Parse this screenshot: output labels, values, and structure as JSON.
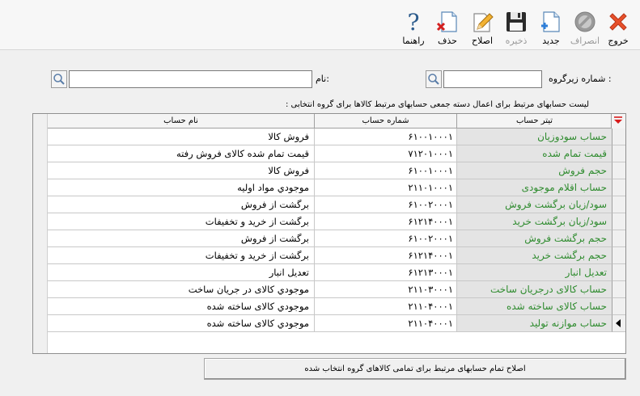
{
  "toolbar": {
    "buttons": [
      {
        "name": "exit",
        "label": "خروج",
        "icon": "close-x-icon",
        "enabled": true
      },
      {
        "name": "cancel",
        "label": "انصراف",
        "icon": "no-entry-icon",
        "enabled": false
      },
      {
        "name": "new",
        "label": "جدید",
        "icon": "new-document-icon",
        "enabled": true
      },
      {
        "name": "save",
        "label": "ذخیره",
        "icon": "floppy-disk-icon",
        "enabled": false
      },
      {
        "name": "edit",
        "label": "اصلاح",
        "icon": "pencil-document-icon",
        "enabled": true
      },
      {
        "name": "delete",
        "label": "حذف",
        "icon": "delete-document-icon",
        "enabled": true
      },
      {
        "name": "help",
        "label": "راهنما",
        "icon": "question-mark-icon",
        "enabled": true
      }
    ]
  },
  "filters": {
    "subgroup_label": "شماره زیرگروه :",
    "subgroup_value": "",
    "name_label": "نام:",
    "name_value": ""
  },
  "list_caption": "لیست حسابهای مرتبط برای اعمال دسته جمعی حسابهای مرتبط کالاها برای  گروه انتخابی :",
  "grid": {
    "columns": {
      "title": "تیتر حساب",
      "number": "شماره حساب",
      "name": "نام حساب"
    },
    "rows": [
      {
        "title": "حساب سودوزیان",
        "number": "۶۱۰۰۱۰۰۰۱",
        "name": "فروش کالا"
      },
      {
        "title": "قیمت تمام شده",
        "number": "۷۱۲۰۱۰۰۰۱",
        "name": "قیمت تمام شده کالای فروش رفته"
      },
      {
        "title": "حجم فروش",
        "number": "۶۱۰۰۱۰۰۰۱",
        "name": "فروش کالا"
      },
      {
        "title": "حساب اقلام موجودی",
        "number": "۲۱۱۰۱۰۰۰۱",
        "name": "موجودي مواد اولیه"
      },
      {
        "title": "سود/زیان برگشت فروش",
        "number": "۶۱۰۰۲۰۰۰۱",
        "name": "برگشت از فروش"
      },
      {
        "title": "سود/زیان برگشت خرید",
        "number": "۶۱۲۱۴۰۰۰۱",
        "name": "برگشت از خرید و تخفیفات"
      },
      {
        "title": "حجم برگشت فروش",
        "number": "۶۱۰۰۲۰۰۰۱",
        "name": "برگشت از فروش"
      },
      {
        "title": "حجم برگشت خرید",
        "number": "۶۱۲۱۴۰۰۰۱",
        "name": "برگشت از خرید و تخفیفات"
      },
      {
        "title": "تعدیل انبار",
        "number": "۶۱۲۱۳۰۰۰۱",
        "name": "تعدیل انبار"
      },
      {
        "title": "حساب کالای درجریان ساخت",
        "number": "۲۱۱۰۳۰۰۰۱",
        "name": "موجودي کالای در جریان ساخت"
      },
      {
        "title": "حساب کالای ساخته شده",
        "number": "۲۱۱۰۴۰۰۰۱",
        "name": "موجودي کالای ساخته شده"
      },
      {
        "title": "حساب موازنه تولید",
        "number": "۲۱۱۰۴۰۰۰۱",
        "name": "موجودي کالای ساخته شده"
      }
    ],
    "current_row_index": 11
  },
  "apply_button_label": "اصلاح تمام حسابهای مرتبط برای تمامی کالاهای گروه انتخاب شده",
  "colors": {
    "title_text": "#2e8b2e",
    "exit_icon": "#e8502a",
    "filter_icon": "#d81b1b"
  }
}
